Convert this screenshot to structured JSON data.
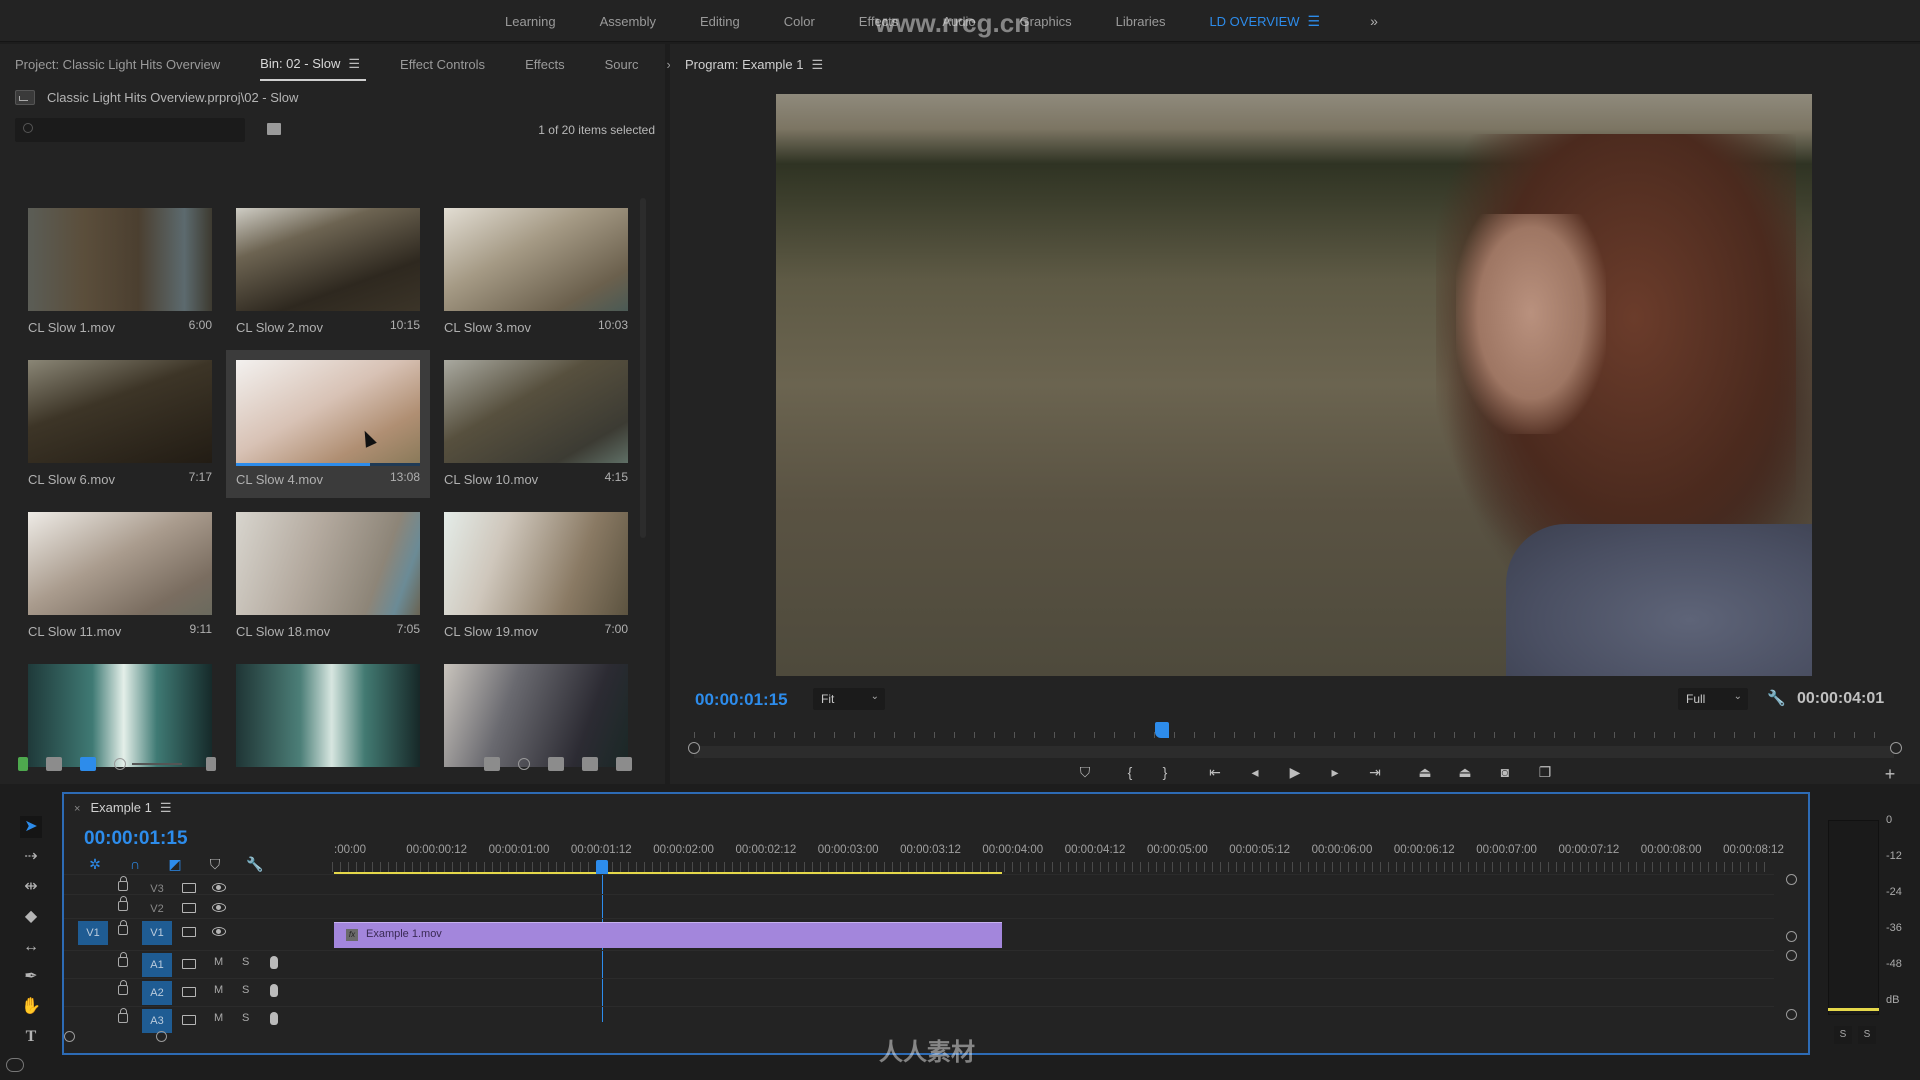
{
  "workspaces": {
    "tabs": [
      "Learning",
      "Assembly",
      "Editing",
      "Color",
      "Effects",
      "Audio",
      "Graphics",
      "Libraries",
      "LD OVERVIEW"
    ],
    "active": "LD OVERVIEW",
    "more_icon": "double-chevron-right-icon"
  },
  "left_panel": {
    "tabs": [
      "Project: Classic Light Hits Overview",
      "Bin: 02 - Slow",
      "Effect Controls",
      "Effects",
      "Sourc"
    ],
    "active_tab": "Bin: 02 - Slow",
    "bin_path": "Classic Light Hits Overview.prproj\\02 - Slow",
    "search_placeholder": "",
    "selection_count": "1 of 20 items selected",
    "clips": [
      {
        "name": "CL Slow 1.mov",
        "duration": "6:00"
      },
      {
        "name": "CL Slow 2.mov",
        "duration": "10:15"
      },
      {
        "name": "CL Slow 3.mov",
        "duration": "10:03"
      },
      {
        "name": "CL Slow 6.mov",
        "duration": "7:17"
      },
      {
        "name": "CL Slow 4.mov",
        "duration": "13:08",
        "selected": true,
        "scrub_progress": 0.73
      },
      {
        "name": "CL Slow 10.mov",
        "duration": "4:15"
      },
      {
        "name": "CL Slow 11.mov",
        "duration": "9:11"
      },
      {
        "name": "CL Slow 18.mov",
        "duration": "7:05"
      },
      {
        "name": "CL Slow 19.mov",
        "duration": "7:00"
      },
      {
        "name": "",
        "duration": ""
      },
      {
        "name": "",
        "duration": ""
      },
      {
        "name": "",
        "duration": ""
      }
    ]
  },
  "program": {
    "title": "Program: Example 1",
    "current_timecode": "00:00:01:15",
    "zoom_level": "Fit",
    "resolution": "Full",
    "duration_timecode": "00:00:04:01",
    "playhead_fraction": 0.39,
    "transport": [
      "add-marker",
      "mark-in",
      "mark-out",
      "go-to-in",
      "step-back",
      "play",
      "step-forward",
      "go-to-out",
      "lift",
      "extract",
      "export-frame",
      "comparison-view",
      "add-button"
    ]
  },
  "timeline": {
    "sequence_name": "Example 1",
    "timecode": "00:00:01:15",
    "ruler_labels": [
      ":00:00",
      "00:00:00:12",
      "00:00:01:00",
      "00:00:01:12",
      "00:00:02:00",
      "00:00:02:12",
      "00:00:03:00",
      "00:00:03:12",
      "00:00:04:00",
      "00:00:04:12",
      "00:00:05:00",
      "00:00:05:12",
      "00:00:06:00",
      "00:00:06:12",
      "00:00:07:00",
      "00:00:07:12",
      "00:00:08:00",
      "00:00:08:12"
    ],
    "tracks": [
      {
        "name": "V3",
        "type": "video",
        "targeted": false
      },
      {
        "name": "V2",
        "type": "video",
        "targeted": false
      },
      {
        "name": "V1",
        "type": "video",
        "targeted": true,
        "source_patch": "V1"
      },
      {
        "name": "A1",
        "type": "audio",
        "targeted": true,
        "mute": "M",
        "solo": "S"
      },
      {
        "name": "A2",
        "type": "audio",
        "targeted": true,
        "mute": "M",
        "solo": "S"
      },
      {
        "name": "A3",
        "type": "audio",
        "targeted": true,
        "mute": "M",
        "solo": "S"
      }
    ],
    "clip": {
      "name": "Example 1.mov",
      "fx_label": "fx",
      "track": "V1"
    }
  },
  "audio_meter": {
    "scale": [
      "0",
      "-12",
      "-24",
      "-36",
      "-48",
      "dB"
    ],
    "solo_buttons": [
      "S",
      "S"
    ]
  },
  "watermarks": {
    "url": "www.rrcg.cn",
    "logo_text": "人人素材"
  },
  "colors": {
    "accent_blue": "#2d8ceb",
    "clip_purple": "#a386dc",
    "work_area_yellow": "#e5d84a",
    "panel_bg": "#232323"
  }
}
